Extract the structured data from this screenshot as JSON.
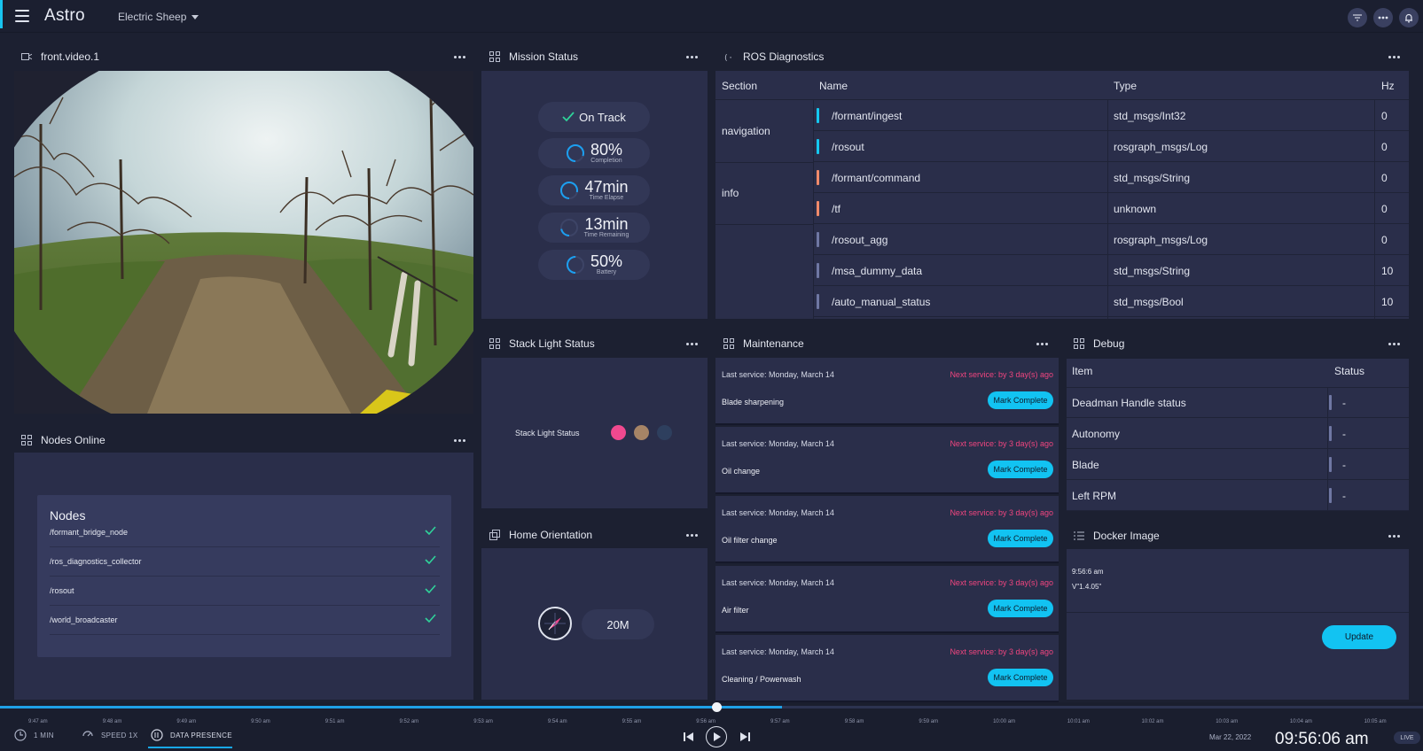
{
  "app": {
    "title": "Astro",
    "device": "Electric Sheep"
  },
  "panels": {
    "video": {
      "title": "front.video.1"
    },
    "mission": {
      "title": "Mission Status"
    },
    "ros": {
      "title": "ROS Diagnostics"
    },
    "stack": {
      "title": "Stack Light Status"
    },
    "maintenance": {
      "title": "Maintenance"
    },
    "debug": {
      "title": "Debug"
    },
    "nodes": {
      "title": "Nodes Online"
    },
    "home": {
      "title": "Home Orientation"
    },
    "docker": {
      "title": "Docker Image"
    }
  },
  "mission": {
    "status": "On Track",
    "metrics": [
      {
        "value": "80%",
        "label": "Completion",
        "progress": 0.8
      },
      {
        "value": "47min",
        "label": "Time Elapse",
        "progress": 0.78
      },
      {
        "value": "13min",
        "label": "Time Remaining",
        "progress": 0.22
      },
      {
        "value": "50%",
        "label": "Battery",
        "progress": 0.5
      }
    ]
  },
  "ros": {
    "columns": [
      "Section",
      "Name",
      "Type",
      "Hz"
    ],
    "sections": [
      "navigation",
      "info"
    ],
    "rows": [
      {
        "name": "/formant/ingest",
        "type": "std_msgs/Int32",
        "hz": "0",
        "color": "#14c8f0"
      },
      {
        "name": "/rosout",
        "type": "rosgraph_msgs/Log",
        "hz": "0",
        "color": "#14c8f0"
      },
      {
        "name": "/formant/command",
        "type": "std_msgs/String",
        "hz": "0",
        "color": "#f08a6a"
      },
      {
        "name": "/tf",
        "type": "unknown",
        "hz": "0",
        "color": "#f08a6a"
      },
      {
        "name": "/rosout_agg",
        "type": "rosgraph_msgs/Log",
        "hz": "0",
        "color": "#6f77a3"
      },
      {
        "name": "/msa_dummy_data",
        "type": "std_msgs/String",
        "hz": "10",
        "color": "#6f77a3"
      },
      {
        "name": "/auto_manual_status",
        "type": "std_msgs/Bool",
        "hz": "10",
        "color": "#6f77a3"
      }
    ]
  },
  "stack": {
    "label": "Stack Light Status",
    "lights": [
      "#f0498f",
      "#a68466",
      "#2e3f5e"
    ]
  },
  "maintenance": {
    "items": [
      {
        "last": "Last service: Monday, March 14",
        "next": "Next service: by 3 day(s) ago",
        "task": "Blade sharpening",
        "button": "Mark Complete"
      },
      {
        "last": "Last service: Monday, March 14",
        "next": "Next service: by 3 day(s) ago",
        "task": "Oil change",
        "button": "Mark Complete"
      },
      {
        "last": "Last service: Monday, March 14",
        "next": "Next service: by 3 day(s) ago",
        "task": "Oil filter change",
        "button": "Mark Complete"
      },
      {
        "last": "Last service: Monday, March 14",
        "next": "Next service: by 3 day(s) ago",
        "task": "Air filter",
        "button": "Mark Complete"
      },
      {
        "last": "Last service: Monday, March 14",
        "next": "Next service: by 3 day(s) ago",
        "task": "Cleaning / Powerwash",
        "button": "Mark Complete"
      }
    ]
  },
  "debug": {
    "columns": [
      "Item",
      "Status"
    ],
    "rows": [
      {
        "item": "Deadman Handle status",
        "status": "-"
      },
      {
        "item": "Autonomy",
        "status": "-"
      },
      {
        "item": "Blade",
        "status": "-"
      },
      {
        "item": "Left RPM",
        "status": "-"
      }
    ]
  },
  "docker": {
    "time": "9:56:6 am",
    "version": "V\"1.4.05\"",
    "button": "Update"
  },
  "nodes": {
    "heading": "Nodes",
    "items": [
      "/formant_bridge_node",
      "/ros_diagnostics_collector",
      "/rosout",
      "/world_broadcaster"
    ]
  },
  "home": {
    "distance": "20M"
  },
  "timeline": {
    "ticks": [
      "9:47 am",
      "9:48 am",
      "9:49 am",
      "9:50 am",
      "9:51 am",
      "9:52 am",
      "9:53 am",
      "9:54 am",
      "9:55 am",
      "9:56 am",
      "9:57 am",
      "9:58 am",
      "9:59 am",
      "10:00 am",
      "10:01 am",
      "10:02 am",
      "10:03 am",
      "10:04 am",
      "10:05 am"
    ],
    "window": "1 MIN",
    "speed": "SPEED 1X",
    "presence": "DATA PRESENCE",
    "date": "Mar 22, 2022",
    "time": "09:56:06 am",
    "live": "LIVE"
  }
}
